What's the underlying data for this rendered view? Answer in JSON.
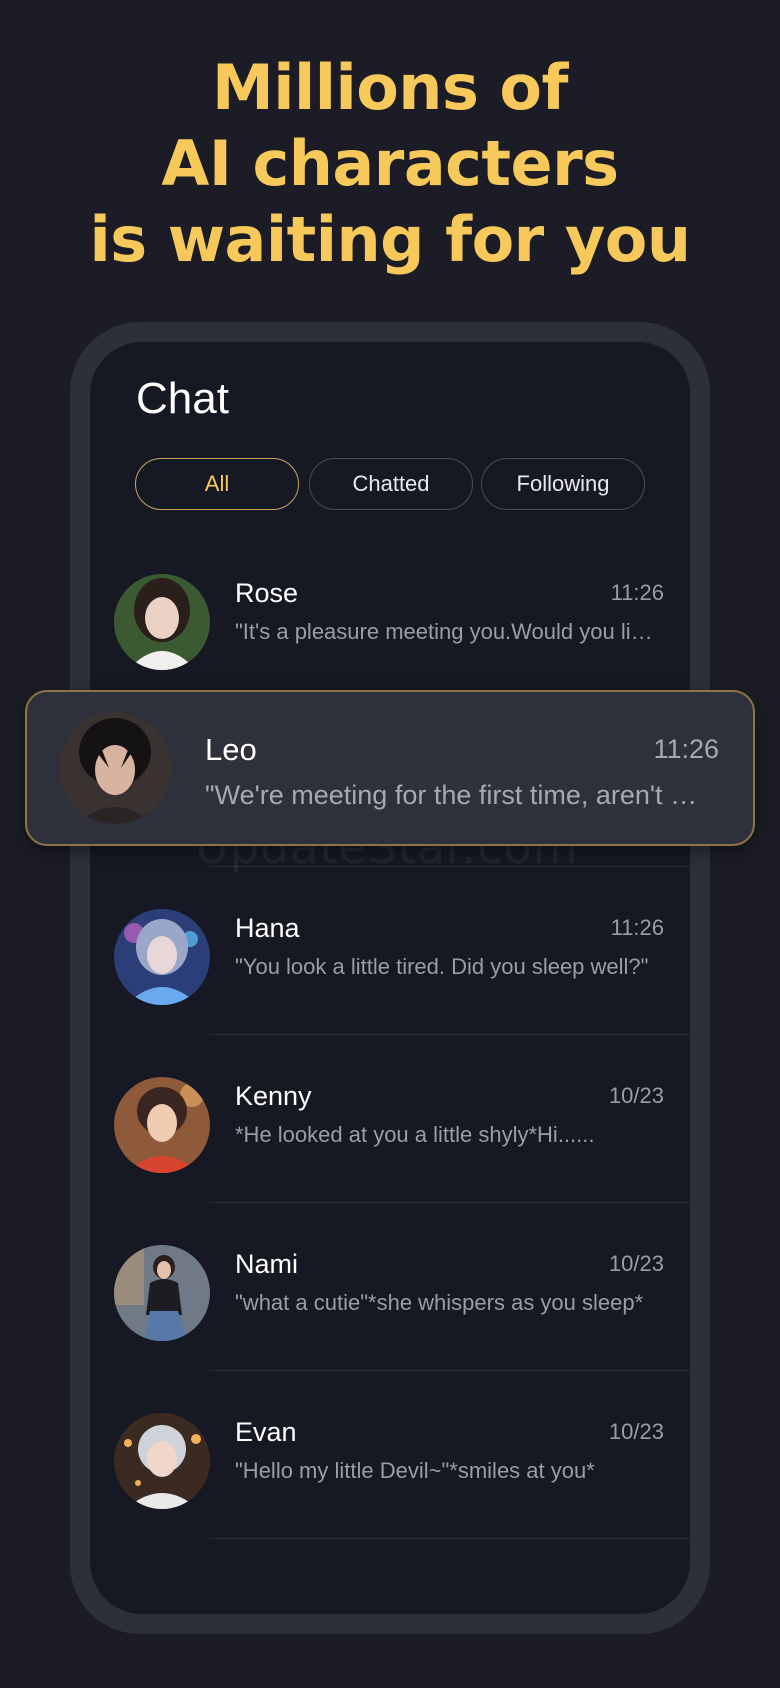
{
  "headline": {
    "line1": "Millions of",
    "line2": "AI characters",
    "line3": "is waiting for you"
  },
  "chat": {
    "title": "Chat",
    "tabs": [
      {
        "label": "All",
        "active": true
      },
      {
        "label": "Chatted",
        "active": false
      },
      {
        "label": "Following",
        "active": false
      }
    ],
    "items": [
      {
        "name": "Rose",
        "time": "11:26",
        "message": "\"It's a pleasure meeting you.Would you like to chat?\""
      },
      {
        "name": "Leo",
        "time": "11:26",
        "message": "\"We're meeting for the first time, aren't we?\""
      },
      {
        "name": "Hana",
        "time": "11:26",
        "message": "\"You look a little tired. Did you sleep well?\""
      },
      {
        "name": "Kenny",
        "time": "10/23",
        "message": "*He looked at you a little shyly*Hi......"
      },
      {
        "name": "Nami",
        "time": "10/23",
        "message": "\"what a cutie\"*she whispers as you sleep*"
      },
      {
        "name": "Evan",
        "time": "10/23",
        "message": "\"Hello my little Devil~\"*smiles at you*"
      }
    ]
  },
  "watermark": "UpdateStar.com",
  "colors": {
    "accent": "#f7c95a",
    "background": "#1b1c25",
    "screen": "#161823",
    "highlight_border": "#8d7440"
  }
}
